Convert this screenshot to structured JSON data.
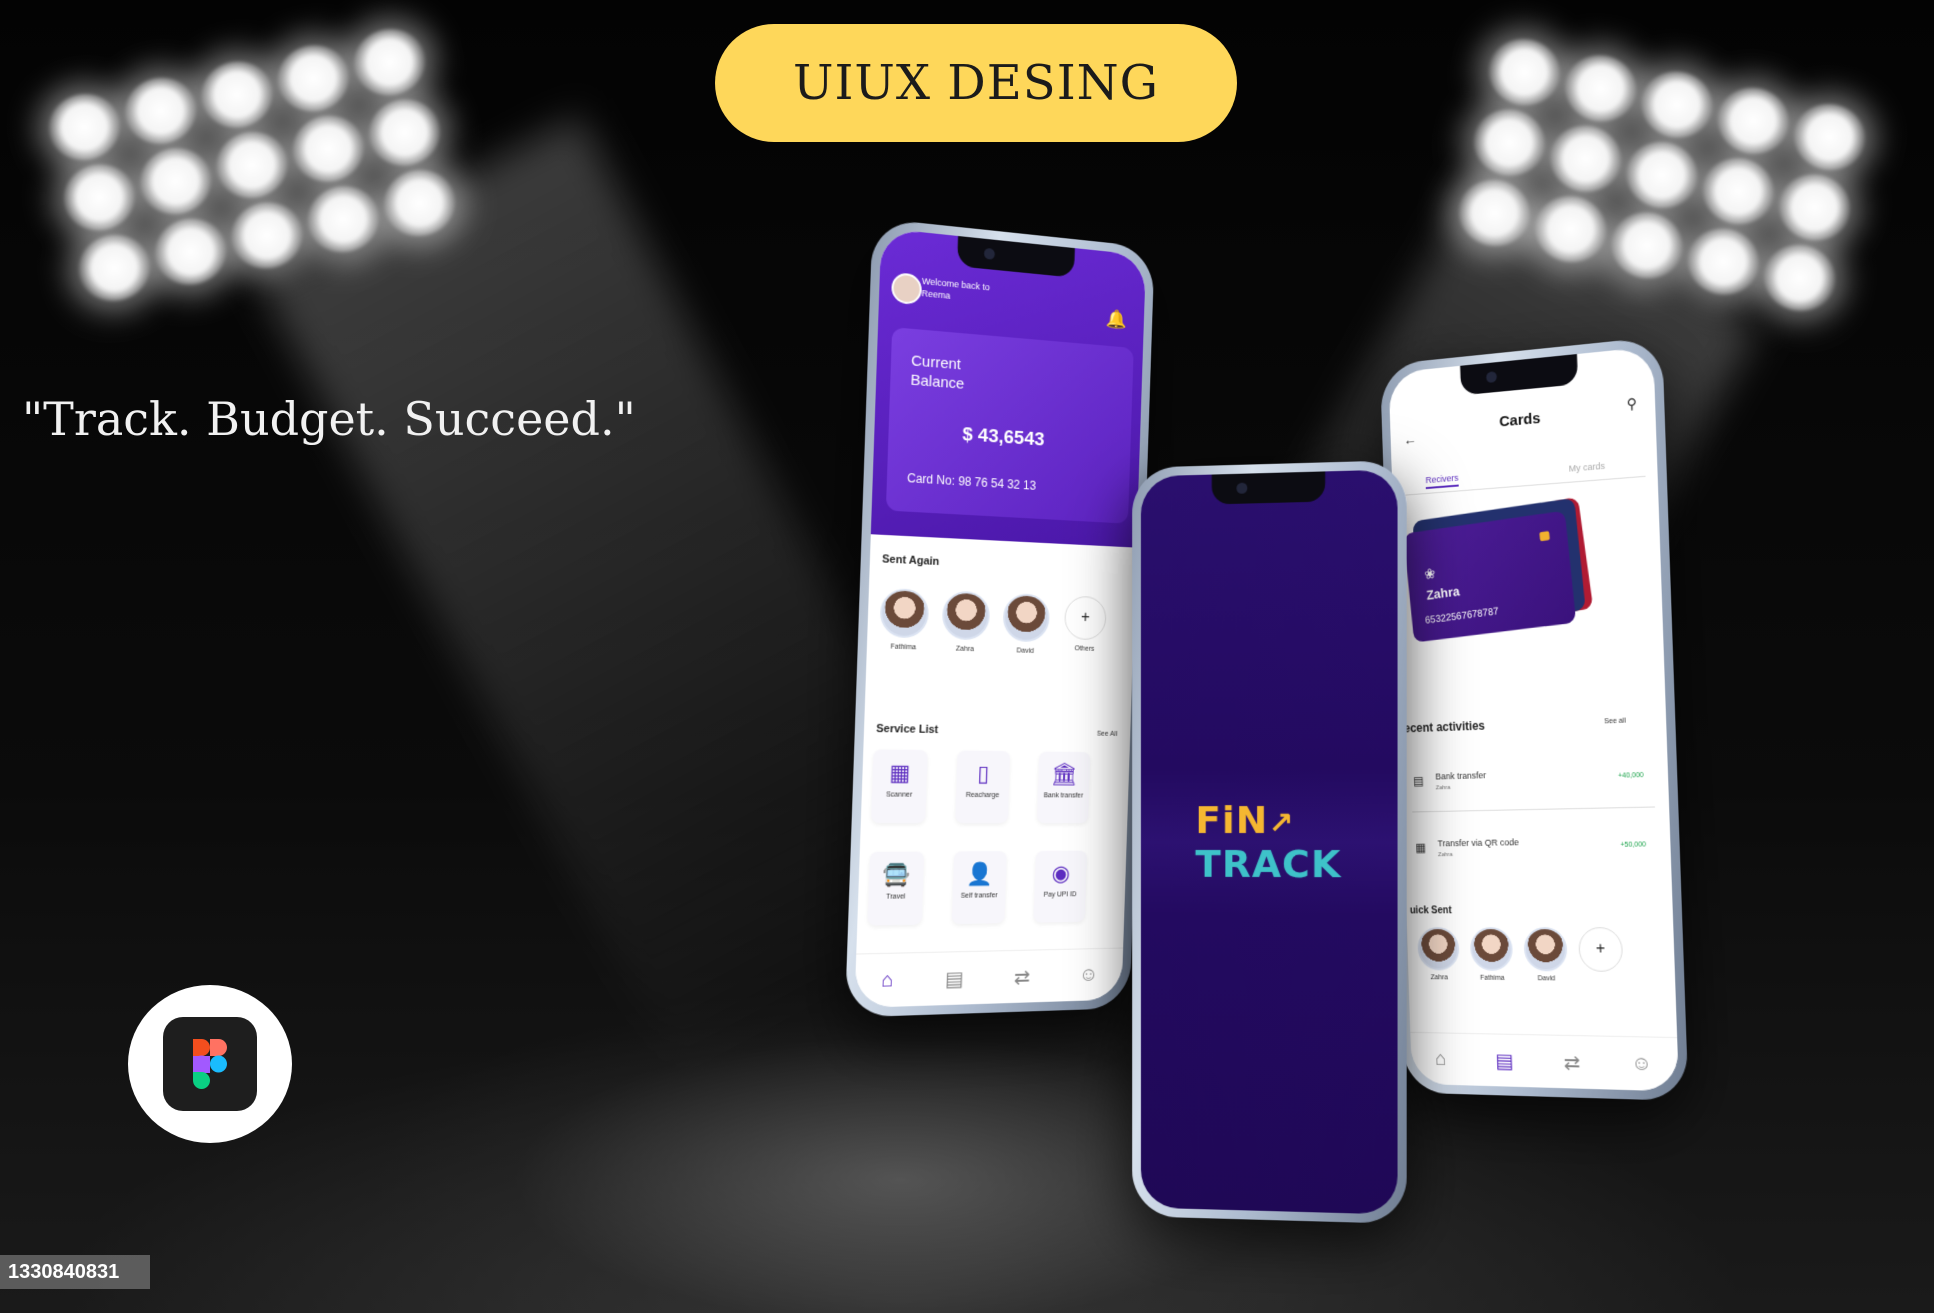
{
  "banner": {
    "title": "UIUX DESING"
  },
  "tagline": "\"Track. Budget. Succeed.\"",
  "watermark": "1330840831",
  "figma_icon": "figma-logo",
  "colors": {
    "pill": "#fed75a",
    "brand_purple": "#5c2cc0",
    "logo_gold": "#f5b731",
    "logo_teal": "#3ec2c9"
  },
  "home_screen": {
    "welcome_line1": "Welcome back to",
    "welcome_name": "Reema",
    "balance_label": "Current Balance",
    "balance_amount": "$ 43,6543",
    "card_no_label": "Card No:",
    "card_no": "98 76 54 32 13",
    "sent_again_title": "Sent Again",
    "contacts": [
      {
        "name": "Fathima"
      },
      {
        "name": "Zahra"
      },
      {
        "name": "David"
      },
      {
        "name": "Others"
      }
    ],
    "service_list_title": "Service List",
    "see_all": "See All",
    "services": [
      {
        "label": "Scanner",
        "icon": "scanner-icon"
      },
      {
        "label": "Reacharge",
        "icon": "phone-icon"
      },
      {
        "label": "Bank transfer",
        "icon": "bank-icon"
      },
      {
        "label": "Travel",
        "icon": "bus-icon"
      },
      {
        "label": "Self transfer",
        "icon": "person-icon"
      },
      {
        "label": "Pay UPI ID",
        "icon": "upi-icon"
      }
    ]
  },
  "splash_screen": {
    "logo_line1": "FiN",
    "logo_line2": "TRACK"
  },
  "cards_screen": {
    "title": "Cards",
    "tab_receivers": "Recivers",
    "tab_my_cards": "My cards",
    "card_holder": "Zahra",
    "card_number": "65322567678787",
    "recent_title": "ecent activities",
    "see_all": "See all",
    "activities": [
      {
        "title": "Bank transfer",
        "sub": "Zahra",
        "amount": "+40,000"
      },
      {
        "title": "Transfer via QR code",
        "sub": "Zahra",
        "amount": "+50,000"
      }
    ],
    "quick_sent_title": "uick Sent",
    "quick_contacts": [
      {
        "name": "Zahra"
      },
      {
        "name": "Fathima"
      },
      {
        "name": "David"
      }
    ]
  }
}
